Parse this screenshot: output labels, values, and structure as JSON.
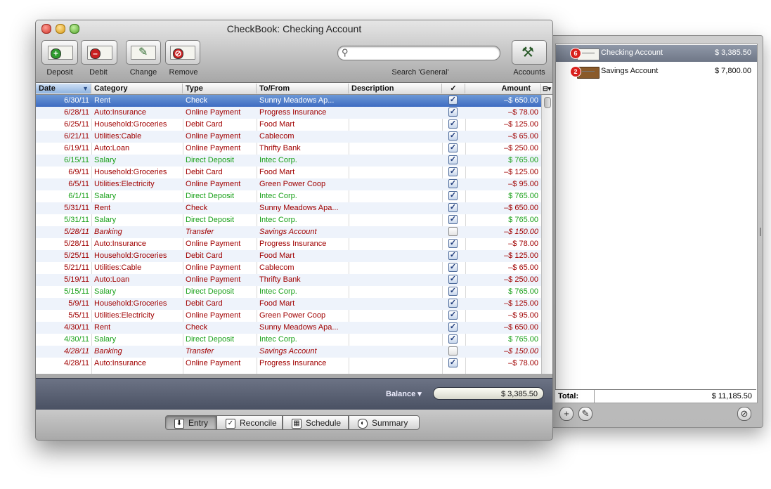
{
  "window": {
    "title": "CheckBook:  Checking Account"
  },
  "toolbar": {
    "deposit": "Deposit",
    "debit": "Debit",
    "change": "Change",
    "remove": "Remove",
    "search_caption": "Search 'General'",
    "search_value": "",
    "accounts": "Accounts"
  },
  "colors": {
    "income": "#18a018",
    "expense": "#a00000",
    "selection": "#3e6cc2",
    "balance_bar": "#5a6173"
  },
  "table": {
    "columns": [
      "Date",
      "Category",
      "Type",
      "To/From",
      "Description",
      "✓",
      "Amount"
    ],
    "rows": [
      {
        "date": "6/30/11",
        "category": "Rent",
        "type": "Check",
        "to": "Sunny Meadows Ap...",
        "desc": "",
        "checked": true,
        "amount": "–$ 650.00",
        "kind": "expense"
      },
      {
        "date": "6/28/11",
        "category": "Auto:Insurance",
        "type": "Online Payment",
        "to": "Progress Insurance",
        "desc": "",
        "checked": true,
        "amount": "–$ 78.00",
        "kind": "expense"
      },
      {
        "date": "6/25/11",
        "category": "Household:Groceries",
        "type": "Debit Card",
        "to": "Food Mart",
        "desc": "",
        "checked": true,
        "amount": "–$ 125.00",
        "kind": "expense"
      },
      {
        "date": "6/21/11",
        "category": "Utilities:Cable",
        "type": "Online Payment",
        "to": "Cablecom",
        "desc": "",
        "checked": true,
        "amount": "–$ 65.00",
        "kind": "expense"
      },
      {
        "date": "6/19/11",
        "category": "Auto:Loan",
        "type": "Online Payment",
        "to": "Thrifty Bank",
        "desc": "",
        "checked": true,
        "amount": "–$ 250.00",
        "kind": "expense"
      },
      {
        "date": "6/15/11",
        "category": "Salary",
        "type": "Direct Deposit",
        "to": "Intec Corp.",
        "desc": "",
        "checked": true,
        "amount": "$ 765.00",
        "kind": "income"
      },
      {
        "date": "6/9/11",
        "category": "Household:Groceries",
        "type": "Debit Card",
        "to": "Food Mart",
        "desc": "",
        "checked": true,
        "amount": "–$ 125.00",
        "kind": "expense"
      },
      {
        "date": "6/5/11",
        "category": "Utilities:Electricity",
        "type": "Online Payment",
        "to": "Green Power Coop",
        "desc": "",
        "checked": true,
        "amount": "–$ 95.00",
        "kind": "expense"
      },
      {
        "date": "6/1/11",
        "category": "Salary",
        "type": "Direct Deposit",
        "to": "Intec Corp.",
        "desc": "",
        "checked": true,
        "amount": "$ 765.00",
        "kind": "income"
      },
      {
        "date": "5/31/11",
        "category": "Rent",
        "type": "Check",
        "to": "Sunny Meadows Apa...",
        "desc": "",
        "checked": true,
        "amount": "–$ 650.00",
        "kind": "expense"
      },
      {
        "date": "5/31/11",
        "category": "Salary",
        "type": "Direct Deposit",
        "to": "Intec Corp.",
        "desc": "",
        "checked": true,
        "amount": "$ 765.00",
        "kind": "income"
      },
      {
        "date": "5/28/11",
        "category": "Banking",
        "type": "Transfer",
        "to": "Savings Account",
        "desc": "",
        "checked": false,
        "amount": "–$ 150.00",
        "kind": "transfer"
      },
      {
        "date": "5/28/11",
        "category": "Auto:Insurance",
        "type": "Online Payment",
        "to": "Progress Insurance",
        "desc": "",
        "checked": true,
        "amount": "–$ 78.00",
        "kind": "expense"
      },
      {
        "date": "5/25/11",
        "category": "Household:Groceries",
        "type": "Debit Card",
        "to": "Food Mart",
        "desc": "",
        "checked": true,
        "amount": "–$ 125.00",
        "kind": "expense"
      },
      {
        "date": "5/21/11",
        "category": "Utilities:Cable",
        "type": "Online Payment",
        "to": "Cablecom",
        "desc": "",
        "checked": true,
        "amount": "–$ 65.00",
        "kind": "expense"
      },
      {
        "date": "5/19/11",
        "category": "Auto:Loan",
        "type": "Online Payment",
        "to": "Thrifty Bank",
        "desc": "",
        "checked": true,
        "amount": "–$ 250.00",
        "kind": "expense"
      },
      {
        "date": "5/15/11",
        "category": "Salary",
        "type": "Direct Deposit",
        "to": "Intec Corp.",
        "desc": "",
        "checked": true,
        "amount": "$ 765.00",
        "kind": "income"
      },
      {
        "date": "5/9/11",
        "category": "Household:Groceries",
        "type": "Debit Card",
        "to": "Food Mart",
        "desc": "",
        "checked": true,
        "amount": "–$ 125.00",
        "kind": "expense"
      },
      {
        "date": "5/5/11",
        "category": "Utilities:Electricity",
        "type": "Online Payment",
        "to": "Green Power Coop",
        "desc": "",
        "checked": true,
        "amount": "–$ 95.00",
        "kind": "expense"
      },
      {
        "date": "4/30/11",
        "category": "Rent",
        "type": "Check",
        "to": "Sunny Meadows Apa...",
        "desc": "",
        "checked": true,
        "amount": "–$ 650.00",
        "kind": "expense"
      },
      {
        "date": "4/30/11",
        "category": "Salary",
        "type": "Direct Deposit",
        "to": "Intec Corp.",
        "desc": "",
        "checked": true,
        "amount": "$ 765.00",
        "kind": "income"
      },
      {
        "date": "4/28/11",
        "category": "Banking",
        "type": "Transfer",
        "to": "Savings Account",
        "desc": "",
        "checked": false,
        "amount": "–$ 150.00",
        "kind": "transfer"
      },
      {
        "date": "4/28/11",
        "category": "Auto:Insurance",
        "type": "Online Payment",
        "to": "Progress Insurance",
        "desc": "",
        "checked": true,
        "amount": "–$ 78.00",
        "kind": "expense"
      }
    ]
  },
  "balance": {
    "label": "Balance ▾",
    "value": "$ 3,385.50"
  },
  "tabs": [
    {
      "label": "Entry",
      "icon": "entry-icon",
      "active": true
    },
    {
      "label": "Reconcile",
      "icon": "reconcile-icon",
      "active": false
    },
    {
      "label": "Schedule",
      "icon": "schedule-icon",
      "active": false
    },
    {
      "label": "Summary",
      "icon": "summary-icon",
      "active": false
    }
  ],
  "accounts": {
    "items": [
      {
        "badge": "6",
        "name": "Checking Account",
        "amount": "$ 3,385.50",
        "icon": "check-icon",
        "selected": true
      },
      {
        "badge": "2",
        "name": "Savings Account",
        "amount": "$ 7,800.00",
        "icon": "treasure-chest-icon",
        "selected": false
      }
    ],
    "total_label": "Total:",
    "total_value": "$ 11,185.50"
  }
}
